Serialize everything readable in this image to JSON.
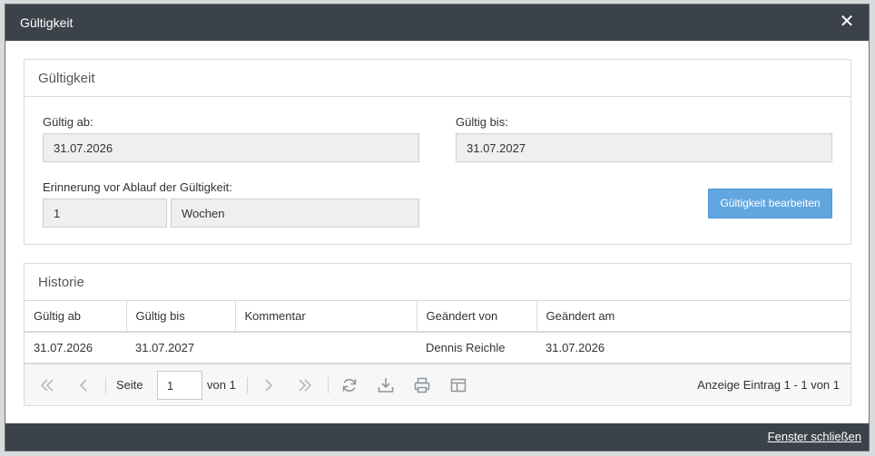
{
  "dialog": {
    "title": "Gültigkeit",
    "close_symbol": "✕",
    "footer_link": "Fenster schließen"
  },
  "validity_panel": {
    "heading": "Gültigkeit",
    "valid_from_label": "Gültig ab:",
    "valid_from_value": "31.07.2026",
    "valid_to_label": "Gültig bis:",
    "valid_to_value": "31.07.2027",
    "reminder_label": "Erinnerung vor Ablauf der Gültigkeit:",
    "reminder_amount": "1",
    "reminder_unit": "Wochen",
    "edit_button": "Gültigkeit bearbeiten"
  },
  "history_panel": {
    "heading": "Historie",
    "columns": [
      "Gültig ab",
      "Gültig bis",
      "Kommentar",
      "Geändert von",
      "Geändert am"
    ],
    "rows": [
      [
        "31.07.2026",
        "31.07.2027",
        "",
        "Dennis Reichle",
        "31.07.2026"
      ]
    ]
  },
  "pager": {
    "page_label": "Seite",
    "page_value": "1",
    "of_label": "von 1",
    "summary": "Anzeige Eintrag 1 - 1 von 1",
    "icons": [
      "first-page-icon",
      "prev-page-icon",
      "next-page-icon",
      "last-page-icon",
      "refresh-icon",
      "download-icon",
      "print-icon",
      "columns-icon"
    ]
  },
  "colors": {
    "titlebar": "#3c4249",
    "accent_button": "#62a6e0"
  }
}
